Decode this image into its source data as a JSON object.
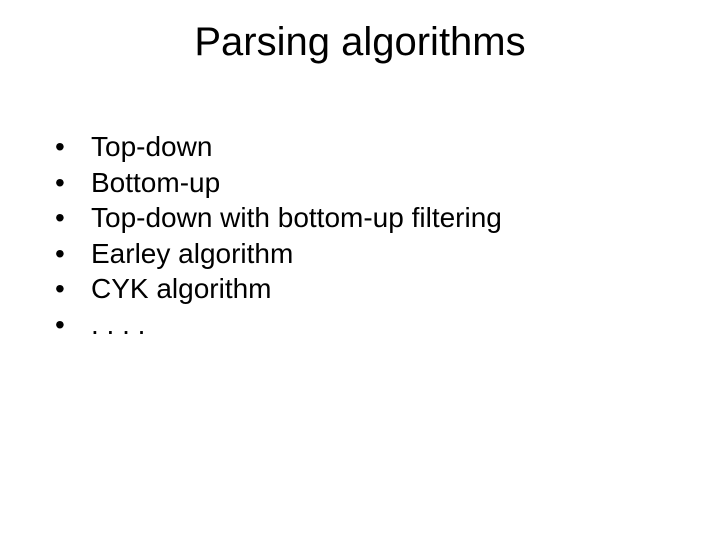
{
  "title": "Parsing algorithms",
  "bullet_char": "•",
  "items": [
    "Top-down",
    "Bottom-up",
    "Top-down with bottom-up filtering",
    "Earley algorithm",
    "CYK algorithm",
    ". . . ."
  ]
}
